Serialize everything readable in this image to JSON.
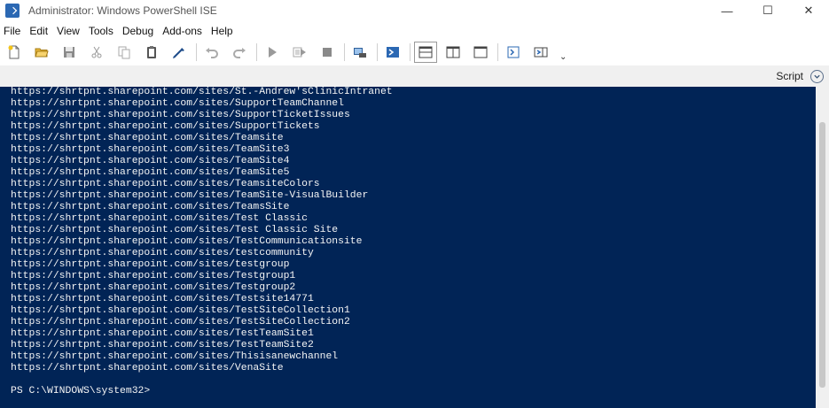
{
  "window": {
    "title": "Administrator: Windows PowerShell ISE",
    "minimize_glyph": "—",
    "maximize_glyph": "☐",
    "close_glyph": "✕"
  },
  "menu": [
    "File",
    "Edit",
    "View",
    "Tools",
    "Debug",
    "Add-ons",
    "Help"
  ],
  "toolbar": {
    "icons": [
      "new-file-icon",
      "open-folder-icon",
      "save-icon",
      "cut-icon",
      "copy-icon",
      "paste-icon",
      "clear-console-icon",
      "undo-icon",
      "redo-icon",
      "run-script-icon",
      "run-selection-icon",
      "stop-icon",
      "new-remote-tab-icon",
      "start-powershell-icon",
      "show-script-top-icon",
      "show-script-right-icon",
      "show-script-maximized-icon",
      "show-command-window-icon",
      "show-command-addon-icon"
    ],
    "overflow_glyph": "⌄"
  },
  "script_pane": {
    "label": "Script",
    "toggle_glyph": "⌄"
  },
  "console": {
    "background": "#012456",
    "text_color": "#f5f5f5",
    "output_lines": [
      "https://shrtpnt.sharepoint.com/sites/St.-Andrew'sClinicIntranet",
      "https://shrtpnt.sharepoint.com/sites/SupportTeamChannel",
      "https://shrtpnt.sharepoint.com/sites/SupportTicketIssues",
      "https://shrtpnt.sharepoint.com/sites/SupportTickets",
      "https://shrtpnt.sharepoint.com/sites/Teamsite",
      "https://shrtpnt.sharepoint.com/sites/TeamSite3",
      "https://shrtpnt.sharepoint.com/sites/TeamSite4",
      "https://shrtpnt.sharepoint.com/sites/TeamSite5",
      "https://shrtpnt.sharepoint.com/sites/TeamsiteColors",
      "https://shrtpnt.sharepoint.com/sites/TeamSite-VisualBuilder",
      "https://shrtpnt.sharepoint.com/sites/TeamsSite",
      "https://shrtpnt.sharepoint.com/sites/Test Classic",
      "https://shrtpnt.sharepoint.com/sites/Test Classic Site",
      "https://shrtpnt.sharepoint.com/sites/TestCommunicationsite",
      "https://shrtpnt.sharepoint.com/sites/testcommunity",
      "https://shrtpnt.sharepoint.com/sites/testgroup",
      "https://shrtpnt.sharepoint.com/sites/Testgroup1",
      "https://shrtpnt.sharepoint.com/sites/Testgroup2",
      "https://shrtpnt.sharepoint.com/sites/Testsite14771",
      "https://shrtpnt.sharepoint.com/sites/TestSiteCollection1",
      "https://shrtpnt.sharepoint.com/sites/TestSiteCollection2",
      "https://shrtpnt.sharepoint.com/sites/TestTeamSite1",
      "https://shrtpnt.sharepoint.com/sites/TestTeamSite2",
      "https://shrtpnt.sharepoint.com/sites/Thisisanewchannel",
      "https://shrtpnt.sharepoint.com/sites/VenaSite"
    ],
    "prompt": "PS C:\\WINDOWS\\system32>"
  }
}
